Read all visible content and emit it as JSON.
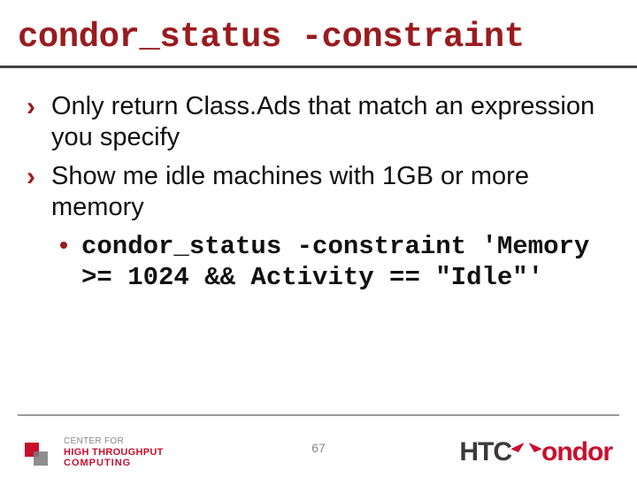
{
  "title": "condor_status -constraint",
  "bullets": [
    "Only return Class.Ads that match an expression you specify",
    "Show me idle machines with 1GB or more memory"
  ],
  "code": "condor_status -constraint 'Memory >= 1024 && Activity == \"Idle\"'",
  "page_number": "67",
  "logo_left": {
    "line1": "CENTER FOR",
    "line2": "HIGH THROUGHPUT",
    "line3": "COMPUTING"
  },
  "logo_right": {
    "part1": "HTC",
    "part2": "ondor"
  }
}
